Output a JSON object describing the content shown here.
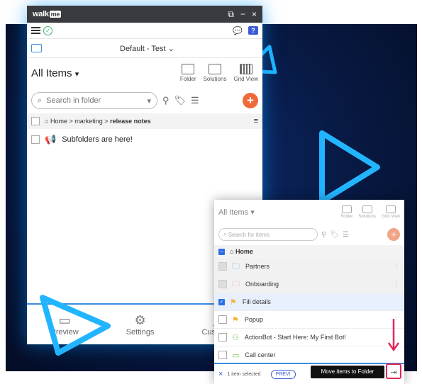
{
  "app": {
    "logo_main": "walk",
    "logo_me": "me"
  },
  "titlebar": {
    "restore_glyph": "⧉",
    "minimize_glyph": "−",
    "close_glyph": "×"
  },
  "toolbar": {
    "help_glyph": "?"
  },
  "environment": {
    "label": "Default - Test",
    "chevron": "⌄"
  },
  "header": {
    "title": "All Items",
    "dropdown_glyph": "▾",
    "tools": [
      {
        "label": "Folder",
        "icon": "folder-add-icon"
      },
      {
        "label": "Solutions",
        "icon": "solutions-icon"
      },
      {
        "label": "Grid View",
        "icon": "grid-view-icon"
      }
    ]
  },
  "search": {
    "placeholder": "Search in folder",
    "plus_glyph": "+"
  },
  "breadcrumb": {
    "home": "Home",
    "sep": ">",
    "level1": "marketing",
    "current": "release notes"
  },
  "items": [
    {
      "label": "Subfolders are here!",
      "icon": "megaphone-icon"
    }
  ],
  "bottom_nav": [
    {
      "label": "Preview",
      "icon": "preview-icon"
    },
    {
      "label": "Settings",
      "icon": "gear-icon"
    },
    {
      "label": "Customize",
      "icon": "paint-roller-icon"
    }
  ],
  "panel": {
    "title": "All Items",
    "dropdown_glyph": "▾",
    "tools": [
      {
        "label": "Folder"
      },
      {
        "label": "Solutions"
      },
      {
        "label": "Grid View"
      }
    ],
    "search_placeholder": "Search for items",
    "plus_glyph": "+",
    "crumb": "Home",
    "rows": [
      {
        "label": "Partners",
        "icon": "folder-icon",
        "color": "#5aa0e8"
      },
      {
        "label": "Onboarding",
        "icon": "folder-icon",
        "color": "#e89aa8"
      },
      {
        "label": "Fill details",
        "icon": "smart-walkthru-icon",
        "color": "#f0b43a"
      },
      {
        "label": "Popup",
        "icon": "smart-walkthru-icon",
        "color": "#f0b43a"
      },
      {
        "label": "ActionBot - Start Here: My First Bot!",
        "icon": "actionbot-icon",
        "color": "#7cc44a"
      },
      {
        "label": "Call center",
        "icon": "launcher-icon",
        "color": "#7cc44a"
      }
    ],
    "footer": {
      "close_glyph": "×",
      "selected_text": "1 item selected",
      "preview_label": "PREVI",
      "tooltip": "Move items to Folder",
      "move_glyph": "⇥"
    }
  },
  "colors": {
    "accent": "#3a8de0",
    "orange": "#ef6a3a",
    "pink_arrow": "#e0285a",
    "bg_dark": "#081a45"
  }
}
